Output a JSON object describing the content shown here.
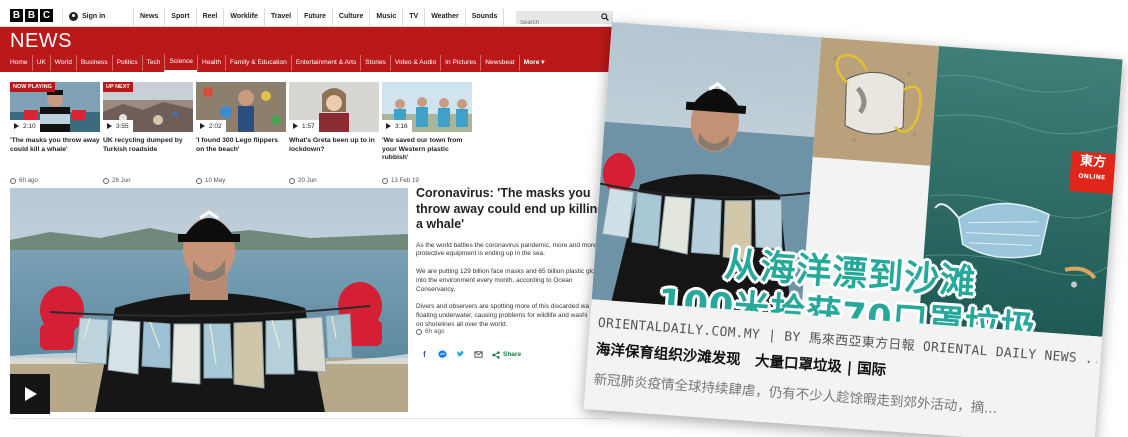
{
  "bbc": {
    "logo": [
      "B",
      "B",
      "C"
    ],
    "signin_label": "Sign in",
    "top_nav": [
      "News",
      "Sport",
      "Reel",
      "Worklife",
      "Travel",
      "Future",
      "Culture",
      "Music",
      "TV",
      "Weather",
      "Sounds"
    ],
    "search_placeholder": "Search",
    "section_title": "NEWS",
    "sub_nav": [
      "Home",
      "UK",
      "World",
      "Business",
      "Politics",
      "Tech",
      "Science",
      "Health",
      "Family & Education",
      "Entertainment & Arts",
      "Stories",
      "Video & Audio",
      "In Pictures",
      "Newsbeat",
      "More ▾"
    ],
    "active_sub_nav": "Science",
    "videos": [
      {
        "badge": "NOW PLAYING",
        "duration": "2:10",
        "title": "'The masks you throw away could kill a whale'",
        "date": "6h ago"
      },
      {
        "badge": "UP NEXT",
        "duration": "3:55",
        "title": "UK recycling dumped by Turkish roadside",
        "date": "26 Jun"
      },
      {
        "badge": "",
        "duration": "2:02",
        "title": "'I found 300 Lego flippers on the beach'",
        "date": "10 May"
      },
      {
        "badge": "",
        "duration": "1:57",
        "title": "What's Greta been up to in lockdown?",
        "date": "20 Jun"
      },
      {
        "badge": "",
        "duration": "3:16",
        "title": "'We saved our town from your Western plastic rubbish'",
        "date": "13 Feb 19"
      }
    ],
    "article": {
      "title": "Coronavirus: 'The masks you throw away could end up killing a whale'",
      "paragraphs": [
        "As the world battles the coronavirus pandemic, more and more\nprotective equipment is ending up in the sea.",
        "We are putting 129 billion face masks and 65 billion plastic glo\ninto the environment every month, according to Ocean\nConservancy.",
        "Divers and observers are spotting more of this discarded wa\nfloating underwater, causing problems for wildlife and washi\non shorelines all over the world."
      ],
      "date": "6h ago",
      "share_label": "Share"
    }
  },
  "oriental_daily": {
    "logo_zh": "東方",
    "logo_en": "ONLINE",
    "headline_line1": "从海洋漂到沙滩",
    "headline_line2": "100米拾获70口罩垃圾",
    "source": "ORIENTALDAILY.COM.MY | BY 馬來西亞東方日報 ORIENTAL DAILY NEWS ...",
    "title": "海洋保育组织沙滩发现　大量口罩垃圾 | 国际",
    "description": "新冠肺炎疫情全球持续肆虐，仍有不少人趁馀暇走到郊外活动，摘..."
  },
  "colors": {
    "bbc_red": "#bb1919",
    "share_green": "#1a7b3c",
    "od_headline_teal": "#26a89a",
    "od_logo_red": "#e0261b"
  },
  "icons": [
    "user-icon",
    "search-icon",
    "play-icon",
    "clock-icon",
    "facebook-icon",
    "messenger-icon",
    "twitter-icon",
    "email-icon",
    "share-icon"
  ]
}
